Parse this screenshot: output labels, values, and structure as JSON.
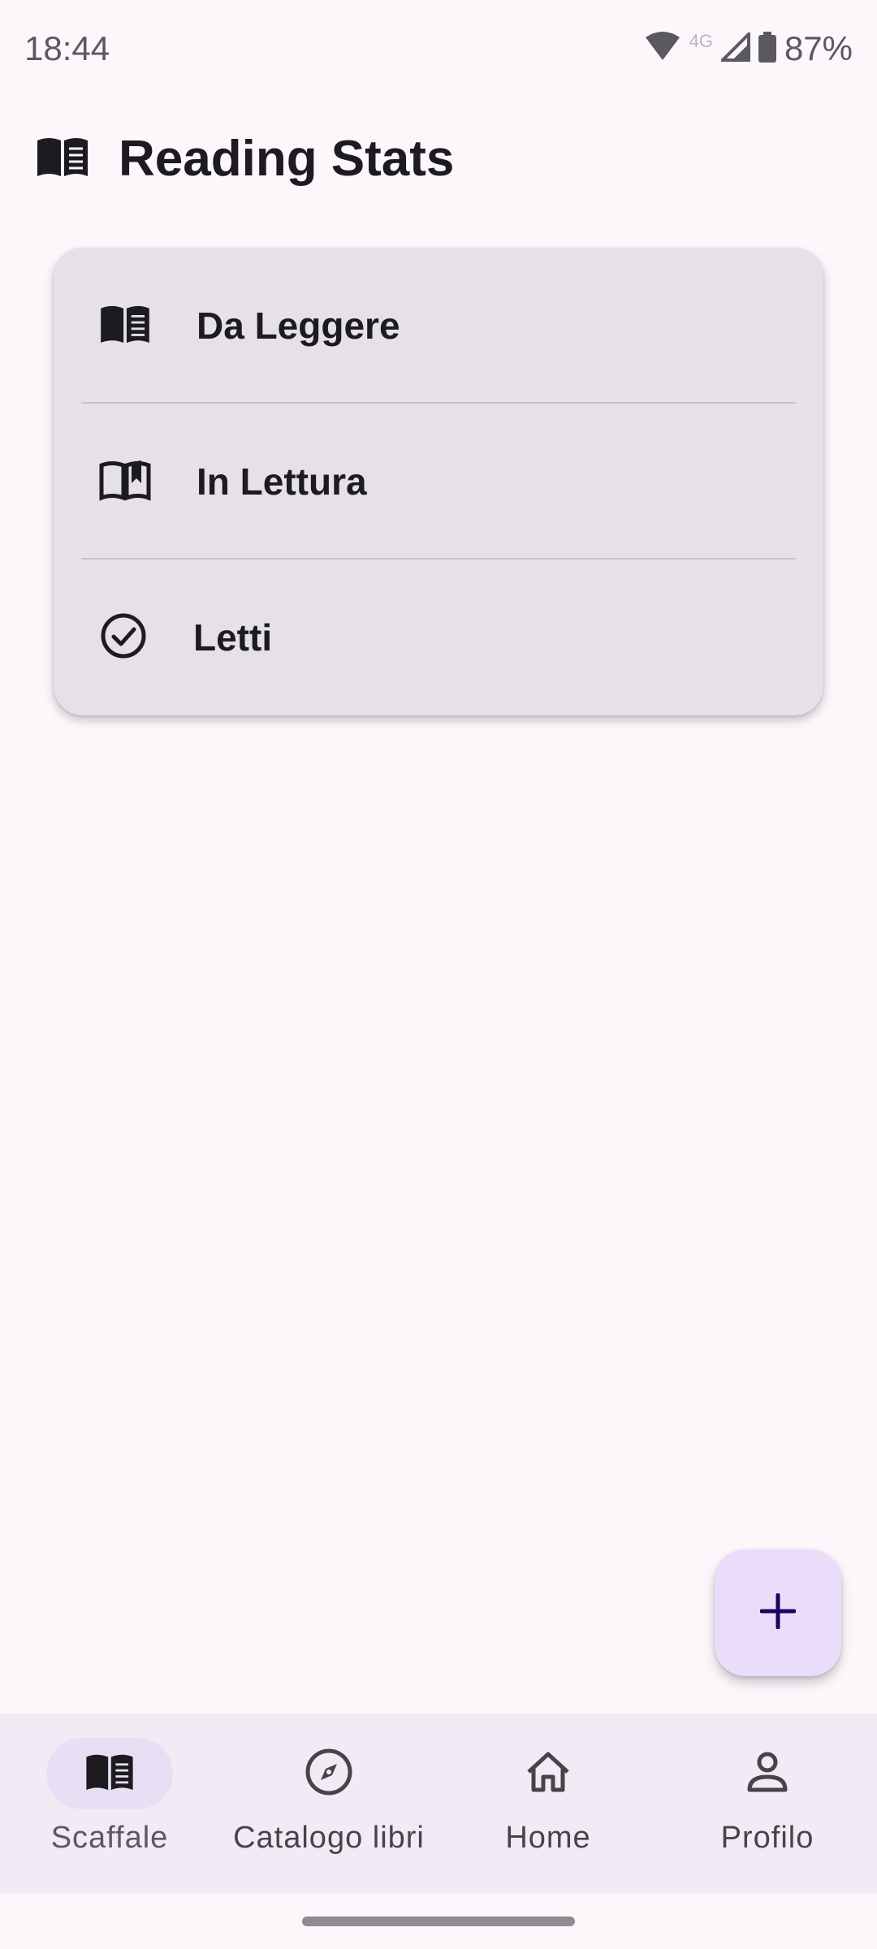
{
  "status_bar": {
    "time": "18:44",
    "network": "4G",
    "battery": "87%"
  },
  "app_bar": {
    "title": "Reading Stats",
    "icon": "book-open-icon"
  },
  "shelves": [
    {
      "label": "Da Leggere",
      "icon": "book-open-filled-icon"
    },
    {
      "label": "In Lettura",
      "icon": "book-open-outline-icon"
    },
    {
      "label": "Letti",
      "icon": "check-circle-icon"
    }
  ],
  "fab": {
    "icon": "plus-icon"
  },
  "bottom_nav": {
    "items": [
      {
        "label": "Scaffale",
        "icon": "book-open-icon",
        "active": true
      },
      {
        "label": "Catalogo libri",
        "icon": "compass-icon",
        "active": false
      },
      {
        "label": "Home",
        "icon": "home-icon",
        "active": false
      },
      {
        "label": "Profilo",
        "icon": "person-icon",
        "active": false
      }
    ]
  },
  "colors": {
    "background": "#FDF7FC",
    "card": "#E6E0E7",
    "fab": "#EADDFA",
    "nav_background": "#F2EBF5",
    "nav_active_pill": "#E9DFF5"
  }
}
